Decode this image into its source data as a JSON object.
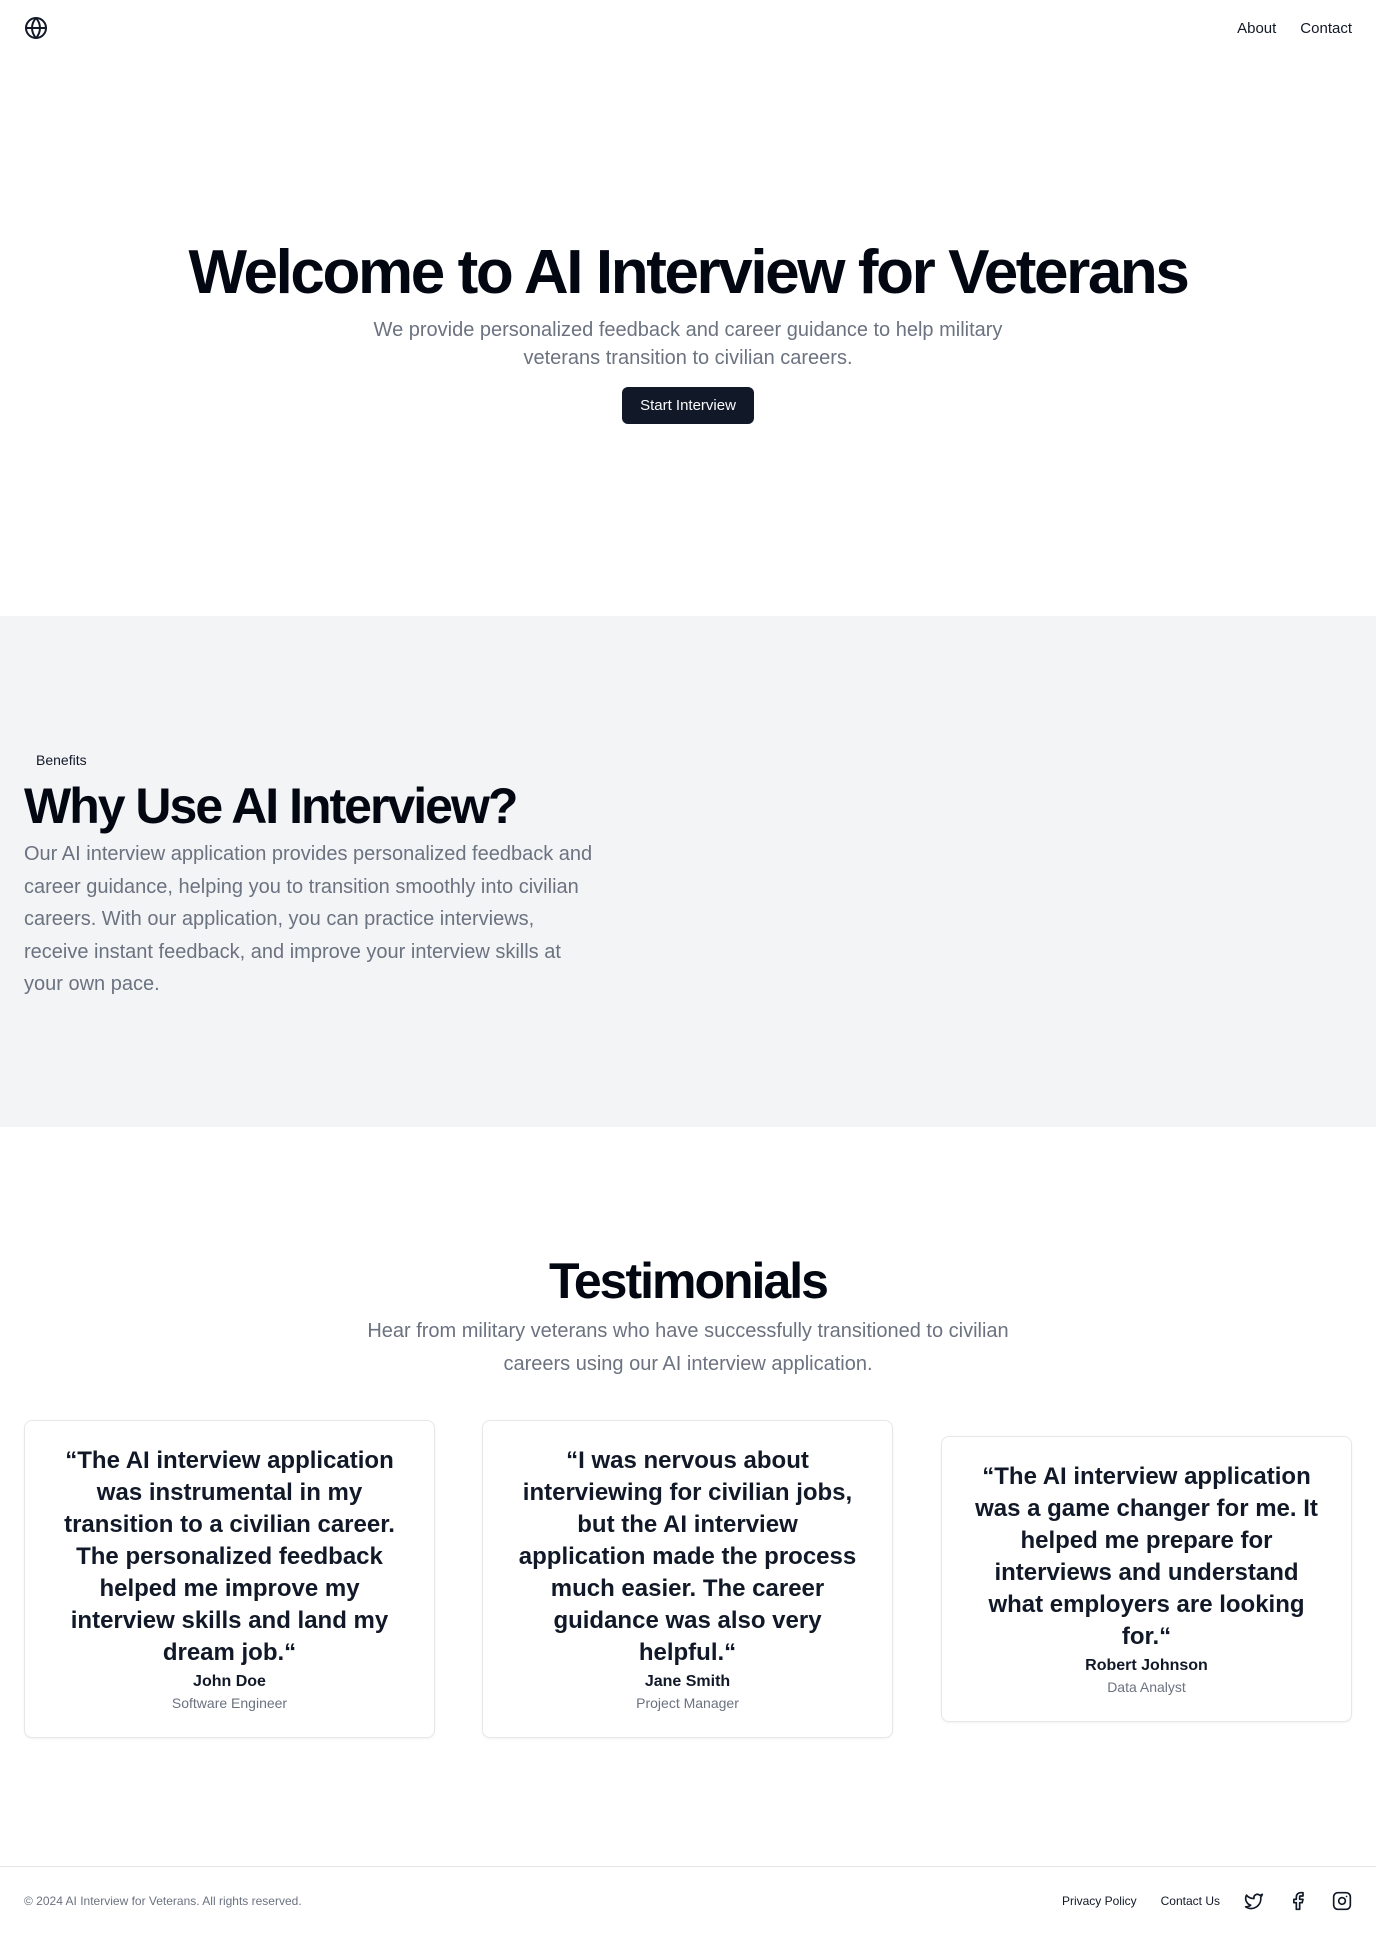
{
  "header": {
    "logo_icon": "globe-icon",
    "nav": [
      {
        "label": "About"
      },
      {
        "label": "Contact"
      }
    ]
  },
  "hero": {
    "title": "Welcome to AI Interview for Veterans",
    "subtitle": "We provide personalized feedback and career guidance to help military veterans transition to civilian careers.",
    "cta_label": "Start Interview"
  },
  "benefits": {
    "badge": "Benefits",
    "title": "Why Use AI Interview?",
    "body": "Our AI interview application provides personalized feedback and career guidance, helping you to transition smoothly into civilian careers. With our application, you can practice interviews, receive instant feedback, and improve your interview skills at your own pace."
  },
  "testimonials": {
    "title": "Testimonials",
    "subtitle": "Hear from military veterans who have successfully transitioned to civilian careers using our AI interview application.",
    "items": [
      {
        "quote": "“The AI interview application was instrumental in my transition to a civilian career. The personalized feedback helped me improve my interview skills and land my dream job.“",
        "name": "John Doe",
        "role": "Software Engineer"
      },
      {
        "quote": "“I was nervous about interviewing for civilian jobs, but the AI interview application made the process much easier. The career guidance was also very helpful.“",
        "name": "Jane Smith",
        "role": "Project Manager"
      },
      {
        "quote": "“The AI interview application was a game changer for me. It helped me prepare for interviews and understand what employers are looking for.“",
        "name": "Robert Johnson",
        "role": "Data Analyst"
      }
    ]
  },
  "footer": {
    "copyright": "© 2024 AI Interview for Veterans. All rights reserved.",
    "links": [
      {
        "label": "Privacy Policy"
      },
      {
        "label": "Contact Us"
      }
    ],
    "social_icons": [
      "twitter-icon",
      "facebook-icon",
      "instagram-icon"
    ]
  },
  "colors": {
    "primary": "#111827",
    "muted_text": "#6b7280",
    "section_bg": "#f3f4f6",
    "border": "#e5e7eb"
  }
}
